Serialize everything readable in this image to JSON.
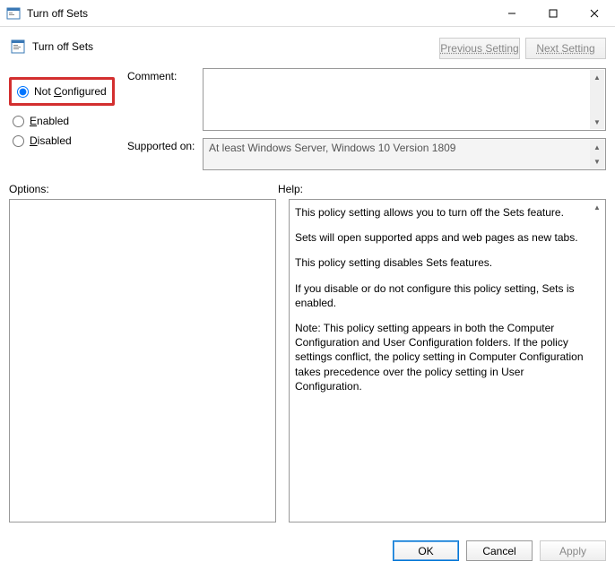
{
  "titlebar": {
    "title": "Turn off Sets"
  },
  "header": {
    "title": "Turn off Sets"
  },
  "nav": {
    "prev": "Previous Setting",
    "next": "Next Setting"
  },
  "radios": {
    "not_configured": "Not Configured",
    "enabled": "Enabled",
    "disabled": "Disabled",
    "selected": "not_configured"
  },
  "labels": {
    "comment": "Comment:",
    "supported": "Supported on:",
    "options": "Options:",
    "help": "Help:"
  },
  "supported_text": "At least Windows Server, Windows 10 Version 1809",
  "help_paragraphs": [
    "This policy setting allows you to turn off the Sets feature.",
    "Sets will open supported apps and web pages as new tabs.",
    "This policy setting disables Sets features.",
    "If you disable or do not configure this policy setting, Sets is enabled.",
    "Note: This policy setting appears in both the Computer Configuration and User Configuration folders. If the policy settings conflict, the policy setting in Computer Configuration takes precedence over the policy setting in User Configuration."
  ],
  "buttons": {
    "ok": "OK",
    "cancel": "Cancel",
    "apply": "Apply"
  }
}
